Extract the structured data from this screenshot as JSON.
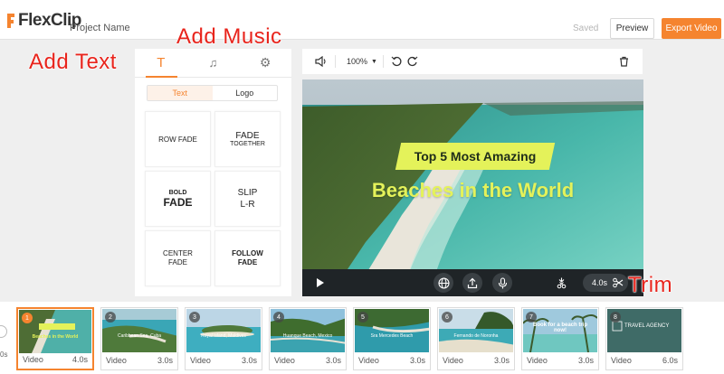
{
  "header": {
    "logo_text": "FlexClip",
    "project_name": "Project Name",
    "saved_label": "Saved",
    "preview_label": "Preview",
    "export_label": "Export Video",
    "accent": "#f5842f"
  },
  "annotations": {
    "add_text": "Add Text",
    "add_music": "Add Music",
    "trim": "Trim",
    "color": "#e8241c"
  },
  "panel": {
    "tabs": [
      {
        "icon": "text-icon",
        "glyph": "T"
      },
      {
        "icon": "music-note-icon",
        "glyph": "♫"
      },
      {
        "icon": "gear-icon",
        "glyph": "⚙"
      }
    ],
    "segments": [
      "Text",
      "Logo"
    ],
    "presets": [
      {
        "line1": "ROW FADE",
        "line2": ""
      },
      {
        "line1": "FADE",
        "line2": "TOGETHER"
      },
      {
        "line1": "BOLD",
        "line2": "FADE"
      },
      {
        "line1": "SLIP",
        "line2": "L-R"
      },
      {
        "line1": "CENTER",
        "line2": "FADE"
      },
      {
        "line1": "FOLLOW",
        "line2": "FADE"
      }
    ]
  },
  "toolbar": {
    "zoom": "100%",
    "icons": [
      "speaker-icon",
      "undo-icon",
      "redo-icon",
      "trash-icon"
    ]
  },
  "preview": {
    "title_line1": "Top 5 Most Amazing",
    "title_line2": "Beaches in the World",
    "duration": "4.0s",
    "highlight": "#e4f25a"
  },
  "timeline": {
    "clips": [
      {
        "num": "1",
        "caption": "Beaches in the World",
        "label": "Video",
        "duration": "4.0s"
      },
      {
        "num": "2",
        "caption": "Caribbean Sea, Cuba",
        "label": "Video",
        "duration": "3.0s"
      },
      {
        "num": "3",
        "caption": "Royal island, Maldives",
        "label": "Video",
        "duration": "3.0s"
      },
      {
        "num": "4",
        "caption": "Huanque Beach, Mexico",
        "label": "Video",
        "duration": "3.0s"
      },
      {
        "num": "5",
        "caption": "Sra Mercedes Beach",
        "label": "Video",
        "duration": "3.0s"
      },
      {
        "num": "6",
        "caption": "Fernando de Noronha",
        "label": "Video",
        "duration": "3.0s"
      },
      {
        "num": "7",
        "caption": "Book for a beach trip now!",
        "label": "Video",
        "duration": "3.0s"
      },
      {
        "num": "8",
        "caption": "TRAVEL AGENCY",
        "label": "Video",
        "duration": "6.0s"
      }
    ],
    "left_time": "0s"
  }
}
